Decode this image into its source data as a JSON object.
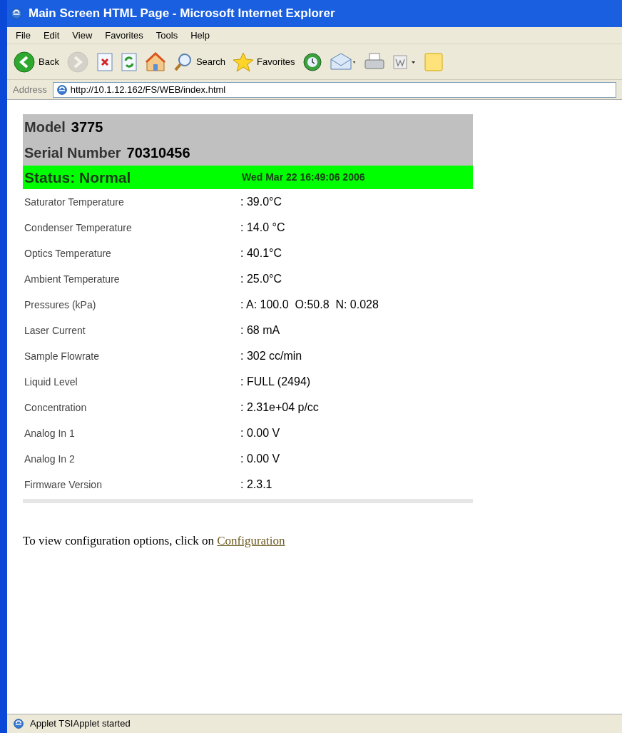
{
  "window": {
    "title": "Main Screen HTML Page - Microsoft Internet Explorer"
  },
  "menu": [
    "File",
    "Edit",
    "View",
    "Favorites",
    "Tools",
    "Help"
  ],
  "toolbar": [
    {
      "kind": "back",
      "label": "Back",
      "disabled": false
    },
    {
      "kind": "forward",
      "disabled": true
    },
    {
      "kind": "stop",
      "disabled": false
    },
    {
      "kind": "refresh",
      "disabled": false
    },
    {
      "kind": "home",
      "disabled": false
    },
    {
      "kind": "search",
      "label": "Search",
      "disabled": false
    },
    {
      "kind": "favorites",
      "label": "Favorites",
      "disabled": false
    },
    {
      "kind": "history",
      "disabled": false
    },
    {
      "kind": "mail",
      "disabled": false
    },
    {
      "kind": "print",
      "disabled": false
    },
    {
      "kind": "word",
      "disabled": false
    },
    {
      "kind": "note",
      "disabled": false
    }
  ],
  "address": {
    "label": "Address",
    "value": "http://10.1.12.162/FS/WEB/index.html"
  },
  "device": {
    "model_label": "Model",
    "model": "3775",
    "serial_label": "Serial Number",
    "serial": "70310456",
    "status": "Status: Normal",
    "timestamp": "Wed Mar 22 16:49:06 2006"
  },
  "readings": [
    {
      "name": "Saturator Temperature",
      "value": ": 39.0°C"
    },
    {
      "name": "Condenser Temperature",
      "value": ": 14.0 °C"
    },
    {
      "name": "Optics Temperature",
      "value": ": 40.1°C"
    },
    {
      "name": "Ambient Temperature",
      "value": ": 25.0°C"
    },
    {
      "name": "Pressures (kPa)",
      "value": ": A: 100.0  O:50.8  N: 0.028"
    },
    {
      "name": "Laser Current",
      "value": ": 68 mA"
    },
    {
      "name": "Sample Flowrate",
      "value": ": 302 cc/min"
    },
    {
      "name": "Liquid Level",
      "value": ": FULL (2494)"
    },
    {
      "name": "Concentration",
      "value": ": 2.31e+04 p/cc"
    },
    {
      "name": "Analog In 1",
      "value": ": 0.00 V"
    },
    {
      "name": "Analog In 2",
      "value": ": 0.00 V"
    },
    {
      "name": "Firmware Version",
      "value": ": 2.3.1"
    }
  ],
  "footer": {
    "text": "To view configuration options, click on",
    "link": "Configuration"
  },
  "status_bar": {
    "text": "Applet TSIApplet started"
  }
}
